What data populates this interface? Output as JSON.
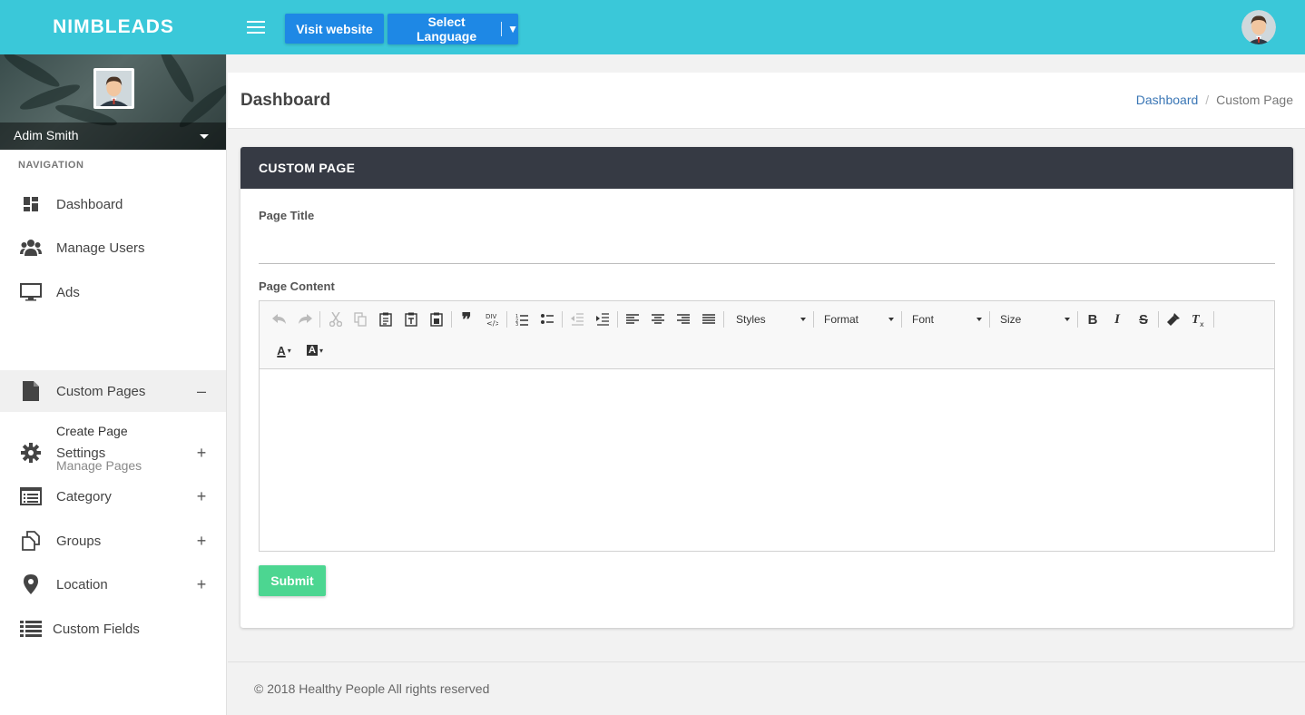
{
  "app": {
    "brand": "NIMBLEADS"
  },
  "topbar": {
    "visit_label": "Visit website",
    "language_label": "Select Language",
    "language_caret": "▼",
    "menu_icon": "hamburger-icon",
    "avatar_icon": "user-avatar"
  },
  "sidebar": {
    "user_name": "Adim Smith",
    "nav_heading": "NAVIGATION",
    "items": [
      {
        "label": "Dashboard",
        "icon": "dashboard-icon",
        "toggle": ""
      },
      {
        "label": "Manage Users",
        "icon": "users-icon",
        "toggle": ""
      },
      {
        "label": "Ads",
        "icon": "monitor-icon",
        "toggle": ""
      },
      {
        "label": "Custom Pages",
        "icon": "file-icon",
        "toggle": "–"
      },
      {
        "label": "Settings",
        "icon": "gear-icon",
        "toggle": "+"
      },
      {
        "label": "Category",
        "icon": "list-box-icon",
        "toggle": "+"
      },
      {
        "label": "Groups",
        "icon": "copy-icon",
        "toggle": "+"
      },
      {
        "label": "Location",
        "icon": "map-pin-icon",
        "toggle": "+"
      },
      {
        "label": "Custom Fields",
        "icon": "list-icon",
        "toggle": ""
      }
    ],
    "sub_items": [
      {
        "label": "Create Page"
      },
      {
        "label": "Manage Pages"
      }
    ]
  },
  "header": {
    "title": "Dashboard",
    "breadcrumb": {
      "home": "Dashboard",
      "separator": "/",
      "current": "Custom Page"
    }
  },
  "card": {
    "title": "CUSTOM PAGE",
    "page_title_label": "Page Title",
    "page_title_value": "",
    "page_content_label": "Page Content",
    "editor": {
      "styles": "Styles",
      "format": "Format",
      "font": "Font",
      "size": "Size",
      "bold": "B",
      "italic": "I",
      "strike": "S",
      "text_color": "A",
      "bg_color": "A"
    },
    "submit_label": "Submit"
  },
  "footer": {
    "text": "© 2018 Healthy People All  rights reserved"
  },
  "colors": {
    "topbar": "#3ac8d9",
    "button_blue": "#1e88e5",
    "card_header": "#363a44",
    "submit_green": "#4cd691",
    "link": "#3a76b5"
  }
}
